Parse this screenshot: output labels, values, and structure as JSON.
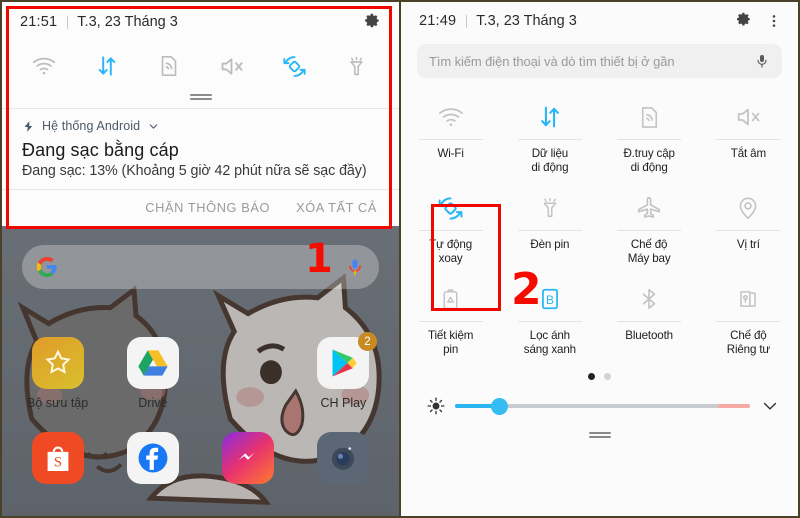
{
  "left_panel": {
    "status_bar": {
      "time": "21:51",
      "date": "T.3, 23 Tháng 3",
      "settings_icon": "gear-icon"
    },
    "quick_toggles": [
      {
        "name": "wifi-icon",
        "label": "Wi-Fi",
        "active": false
      },
      {
        "name": "mobile-data-icon",
        "label": "Dữ liệu di động",
        "active": true
      },
      {
        "name": "hotspot-icon",
        "label": "Đ.truy cập di động",
        "active": false
      },
      {
        "name": "mute-icon",
        "label": "Tắt âm",
        "active": false
      },
      {
        "name": "auto-rotate-icon",
        "label": "Tự động xoay",
        "active": true
      },
      {
        "name": "flashlight-icon",
        "label": "Đèn pin",
        "active": false
      }
    ],
    "notification": {
      "app_name": "Hệ thống Android",
      "title": "Đang sạc bằng cáp",
      "body": "Đang sạc: 13% (Khoảng 5 giờ 42 phút nữa sẽ sạc đầy)",
      "battery_percent": "13%",
      "lightning_icon": "lightning-bolt-icon",
      "expand_icon": "chevron-down-icon"
    },
    "notification_actions": {
      "block": "CHẶN THÔNG BÁO",
      "clear_all": "XÓA TẤT CẢ"
    },
    "home": {
      "search_placeholder": "",
      "google_icon": "google-g-icon",
      "mic_icon": "microphone-icon",
      "apps": [
        {
          "label": "Bộ sưu tập",
          "icon": "gallery-icon",
          "badge": ""
        },
        {
          "label": "Drive",
          "icon": "google-drive-icon",
          "badge": ""
        },
        {
          "label": "",
          "icon": "",
          "badge": ""
        },
        {
          "label": "CH Play",
          "icon": "google-play-icon",
          "badge": "2"
        },
        {
          "label": "",
          "icon": "shopee-icon",
          "badge": ""
        },
        {
          "label": "",
          "icon": "facebook-icon",
          "badge": ""
        },
        {
          "label": "",
          "icon": "messenger-icon",
          "badge": ""
        },
        {
          "label": "",
          "icon": "camera-icon",
          "badge": ""
        }
      ]
    },
    "annotation": {
      "step_number": "1"
    }
  },
  "right_panel": {
    "status_bar": {
      "time": "21:49",
      "date": "T.3, 23 Tháng 3",
      "settings_icon": "gear-icon",
      "more_icon": "overflow-menu-icon"
    },
    "search": {
      "placeholder": "Tìm kiếm điện thoại và dò tìm thiết bị ở gần",
      "mic_icon": "microphone-icon"
    },
    "tiles": [
      {
        "label": "Wi-Fi",
        "icon": "wifi-icon",
        "active": false
      },
      {
        "label": "Dữ liệu\ndi động",
        "icon": "mobile-data-icon",
        "active": true
      },
      {
        "label": "Đ.truy cập\ndi động",
        "icon": "hotspot-icon",
        "active": false
      },
      {
        "label": "Tắt âm",
        "icon": "mute-icon",
        "active": false
      },
      {
        "label": "Tự động\nxoay",
        "icon": "auto-rotate-icon",
        "active": true
      },
      {
        "label": "Đèn pin",
        "icon": "flashlight-icon",
        "active": false
      },
      {
        "label": "Chế độ\nMáy bay",
        "icon": "airplane-icon",
        "active": false
      },
      {
        "label": "Vị trí",
        "icon": "location-pin-icon",
        "active": false
      },
      {
        "label": "Tiết kiệm\npin",
        "icon": "battery-saver-icon",
        "active": false
      },
      {
        "label": "Lọc ánh\nsáng xanh",
        "icon": "blue-light-filter-icon",
        "active": true
      },
      {
        "label": "Bluetooth",
        "icon": "bluetooth-icon",
        "active": false
      },
      {
        "label": "Chế độ\nRiêng tư",
        "icon": "private-mode-icon",
        "active": false
      }
    ],
    "pagination": {
      "total": 2,
      "current": 1
    },
    "brightness": {
      "icon": "brightness-icon",
      "value_percent": 15,
      "collapse_icon": "chevron-down-icon"
    },
    "annotation": {
      "step_number": "2"
    }
  },
  "colors": {
    "accent_blue": "#29b6f6",
    "annotation_red": "#f50b00",
    "panel_bg": "#fbfbfb",
    "inactive_gray": "#b9b9b9"
  }
}
